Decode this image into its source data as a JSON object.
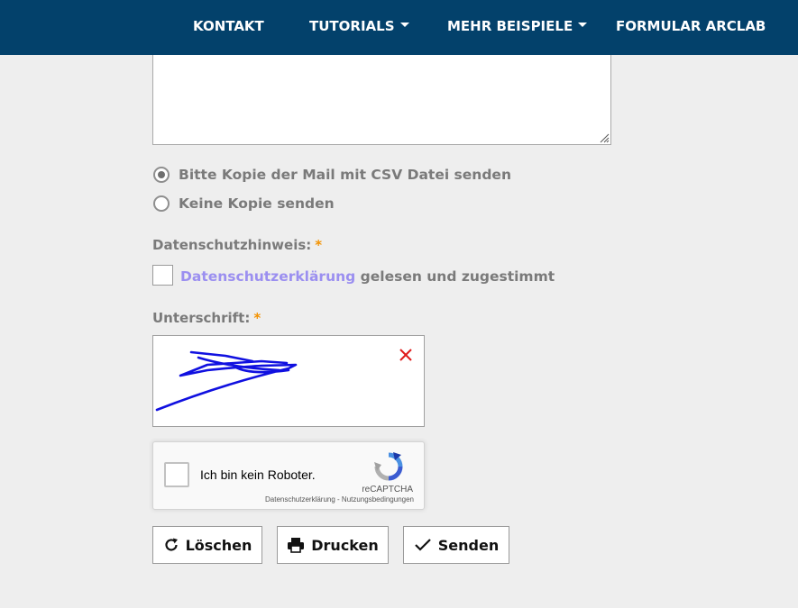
{
  "nav": {
    "items": [
      {
        "label": "KONTAKT",
        "has_dropdown": false
      },
      {
        "label": "TUTORIALS",
        "has_dropdown": true
      },
      {
        "label": "MEHR BEISPIELE",
        "has_dropdown": true
      },
      {
        "label": "FORMULAR ARCLAB",
        "has_dropdown": false
      }
    ],
    "background": "#03416b"
  },
  "form": {
    "message_value": "",
    "copy_options": [
      {
        "label": "Bitte Kopie der Mail mit CSV Datei senden",
        "selected": true
      },
      {
        "label": "Keine Kopie senden",
        "selected": false
      }
    ],
    "privacy": {
      "label": "Datenschutzhinweis:",
      "required_mark": "*",
      "link_text": "Datenschutzerklärung",
      "consent_text": "gelesen und zugestimmt",
      "checked": false
    },
    "signature": {
      "label": "Unterschrift:",
      "required_mark": "*",
      "clear_icon": "close-icon",
      "stroke_color": "#1010e0"
    },
    "recaptcha": {
      "checkbox_label": "Ich bin kein Roboter.",
      "brand": "reCAPTCHA",
      "links": "Datenschutzerklärung - Nutzungsbedingungen",
      "checked": false
    },
    "buttons": {
      "reset_label": "Löschen",
      "reset_icon": "refresh-icon",
      "print_label": "Drucken",
      "print_icon": "print-icon",
      "send_label": "Senden",
      "send_icon": "check-icon"
    }
  },
  "colors": {
    "required": "#f39200",
    "link": "#9b8ff0",
    "page_background": "#eeeeee"
  }
}
